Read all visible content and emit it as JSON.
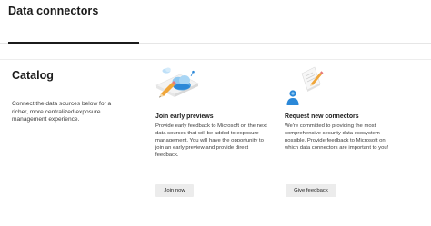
{
  "header": {
    "title": "Data connectors"
  },
  "catalog": {
    "heading": "Catalog",
    "description": "Connect the data sources below for a richer, more centralized exposure management experience."
  },
  "cards": [
    {
      "title": "Join early previews",
      "description": "Provide early feedback to Microsoft on the next data sources that will be added to exposure management. You will have the opportunity to join an early preview and provide direct feedback.",
      "button_label": "Join now",
      "icon": "cloud-pencil-illustration"
    },
    {
      "title": "Request new connectors",
      "description": "We're committed to providing the most comprehensive security data ecosystem possible. Provide feedback to Microsoft on which data connectors are important to you!",
      "button_label": "Give feedback",
      "icon": "person-document-illustration"
    }
  ],
  "colors": {
    "accent_blue": "#2b88d8",
    "light_blue": "#8fc8f0",
    "pencil_orange": "#f0a63a",
    "button_bg": "#ececec"
  }
}
